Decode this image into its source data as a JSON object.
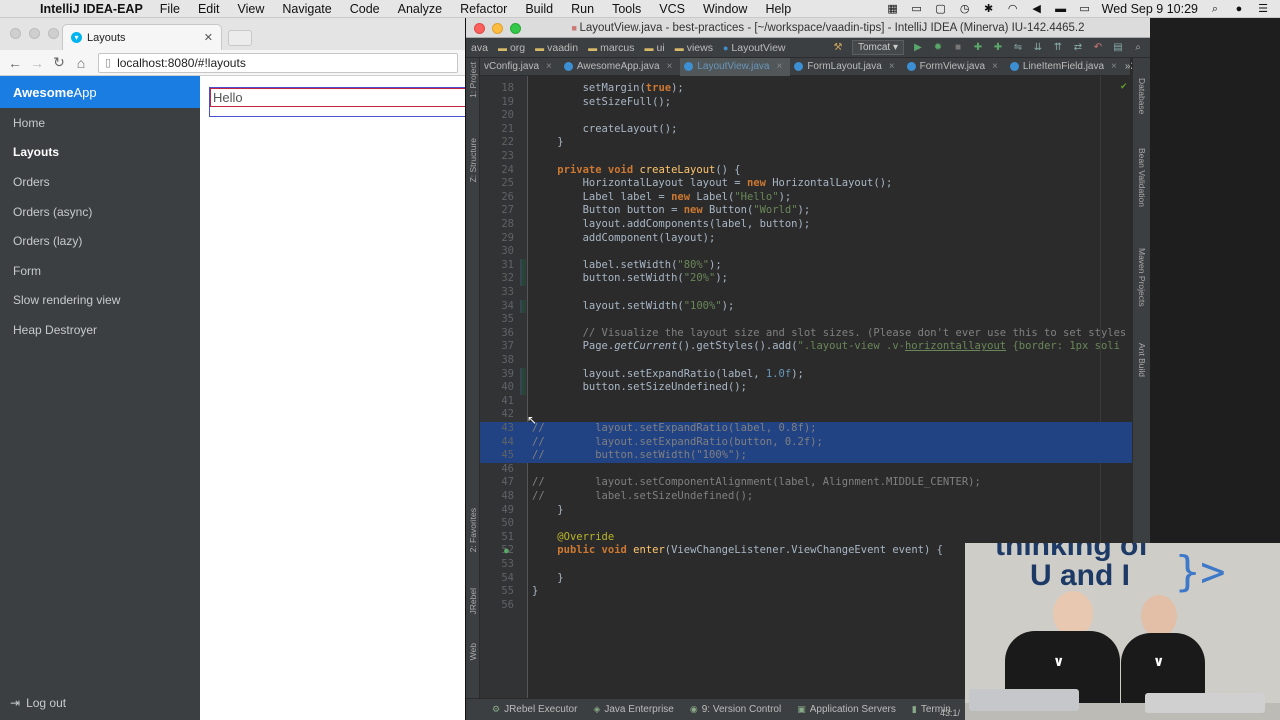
{
  "menubar": {
    "app_name": "IntelliJ IDEA-EAP",
    "menus": [
      "File",
      "Edit",
      "View",
      "Navigate",
      "Code",
      "Analyze",
      "Refactor",
      "Build",
      "Run",
      "Tools",
      "VCS",
      "Window",
      "Help"
    ],
    "clock": "Wed Sep 9  10:29"
  },
  "browser": {
    "tab_title": "Layouts",
    "url": "localhost:8080/#!layouts"
  },
  "app": {
    "title_bold": "Awesome",
    "title_rest": "App",
    "nav": [
      "Home",
      "Layouts",
      "Orders",
      "Orders (async)",
      "Orders (lazy)",
      "Form",
      "Slow rendering view",
      "Heap Destroyer"
    ],
    "active_nav": "Layouts",
    "logout": "Log out",
    "hello": "Hello"
  },
  "ide": {
    "title": "LayoutView.java - best-practices - [~/workspace/vaadin-tips] - IntelliJ IDEA (Minerva) IU-142.4465.2",
    "breadcrumbs": [
      "ava",
      "org",
      "vaadin",
      "marcus",
      "ui",
      "views",
      "LayoutView"
    ],
    "run_config": "Tomcat",
    "tabs": [
      "vConfig.java",
      "AwesomeApp.java",
      "LayoutView.java",
      "FormLayout.java",
      "FormView.java",
      "LineItemField.java"
    ],
    "tabs_more": "»2",
    "active_tab": "LayoutView.java",
    "left_tools": [
      "1: Project",
      "Z: Structure",
      "2: Favorites",
      "JRebel",
      "Web"
    ],
    "right_tools": [
      "Database",
      "Bean Validation",
      "Maven Projects",
      "Ant Build"
    ],
    "bottom_tools": [
      "JRebel Executor",
      "Java Enterprise",
      "9: Version Control",
      "Application Servers",
      "Termin"
    ],
    "status_pos": "43:1/"
  },
  "code": [
    {
      "n": "18",
      "html": "        setMargin(<span class='kw'>true</span>);"
    },
    {
      "n": "19",
      "html": "        setSizeFull();"
    },
    {
      "n": "20",
      "html": ""
    },
    {
      "n": "21",
      "html": "        createLayout();"
    },
    {
      "n": "22",
      "html": "    }"
    },
    {
      "n": "23",
      "html": ""
    },
    {
      "n": "24",
      "html": "    <span class='kw'>private void</span> <span class='meth'>createLayout</span>() {"
    },
    {
      "n": "25",
      "html": "        HorizontalLayout layout = <span class='kw'>new</span> HorizontalLayout();"
    },
    {
      "n": "26",
      "html": "        Label label = <span class='kw'>new</span> Label(<span class='str'>\"Hello\"</span>);"
    },
    {
      "n": "27",
      "html": "        Button button = <span class='kw'>new</span> Button(<span class='str'>\"World\"</span>);"
    },
    {
      "n": "28",
      "html": "        layout.addComponents(label, button);"
    },
    {
      "n": "29",
      "html": "        addComponent(layout);"
    },
    {
      "n": "30",
      "html": ""
    },
    {
      "n": "31",
      "html": "        label.setWidth(<span class='str'>\"80%\"</span>);"
    },
    {
      "n": "32",
      "html": "        button.setWidth(<span class='str'>\"20%\"</span>);"
    },
    {
      "n": "33",
      "html": ""
    },
    {
      "n": "34",
      "html": "        layout.setWidth(<span class='str'>\"100%\"</span>);"
    },
    {
      "n": "35",
      "html": ""
    },
    {
      "n": "36",
      "html": "        <span class='cmt'>// Visualize the layout size and slot sizes. (Please don't ever use this to set styles</span>"
    },
    {
      "n": "37",
      "html": "        Page.<span class='it'>getCurrent</span>().getStyles().add(<span class='str'>\".layout-view .v-</span><span class='underline'>horizontallayout</span><span class='str'> {border: 1px soli</span>"
    },
    {
      "n": "38",
      "html": ""
    },
    {
      "n": "39",
      "html": "        layout.setExpandRatio(label, <span class='num'>1.0f</span>);"
    },
    {
      "n": "40",
      "html": "        button.setSizeUndefined();"
    },
    {
      "n": "41",
      "html": ""
    },
    {
      "n": "42",
      "html": ""
    },
    {
      "n": "43",
      "html": "<span class='cmt'>//        layout.setExpandRatio(label, 0.8f);</span>",
      "sel": true
    },
    {
      "n": "44",
      "html": "<span class='cmt'>//        layout.setExpandRatio(button, 0.2f);</span>",
      "sel": true
    },
    {
      "n": "45",
      "html": "<span class='cmt'>//        button.setWidth(\"100%\");</span>",
      "sel": true
    },
    {
      "n": "46",
      "html": ""
    },
    {
      "n": "47",
      "html": "<span class='cmt'>//        layout.setComponentAlignment(label, Alignment.MIDDLE_CENTER);</span>"
    },
    {
      "n": "48",
      "html": "<span class='cmt'>//        label.setSizeUndefined();</span>"
    },
    {
      "n": "49",
      "html": "    }"
    },
    {
      "n": "50",
      "html": ""
    },
    {
      "n": "51",
      "html": "    <span class='ann'>@Override</span>"
    },
    {
      "n": "52",
      "html": "    <span class='kw'>public void</span> <span class='meth'>enter</span>(ViewChangeListener.ViewChangeEvent event) {"
    },
    {
      "n": "53",
      "html": ""
    },
    {
      "n": "54",
      "html": "    }"
    },
    {
      "n": "55",
      "html": "}"
    },
    {
      "n": "56",
      "html": ""
    }
  ],
  "webcam": {
    "sign_line1": "thinking of",
    "sign_line2": "U and I",
    "brace": "}>"
  }
}
